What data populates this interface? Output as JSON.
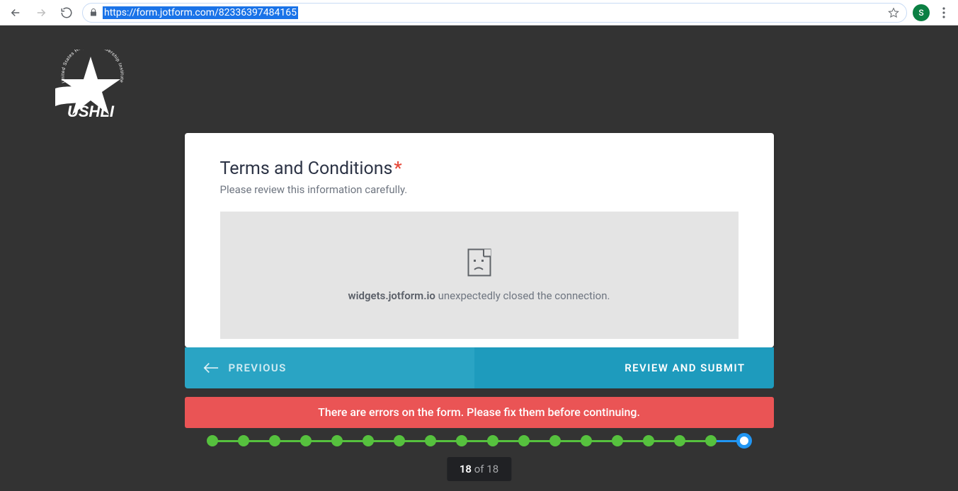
{
  "browser": {
    "url": "https://form.jotform.com/82336397484165",
    "profile_initial": "S"
  },
  "logo": {
    "org_name": "USHLI",
    "tagline": "United States Hispanic Leadership Institute"
  },
  "card": {
    "title": "Terms and Conditions",
    "required": true,
    "subtitle": "Please review this information carefully.",
    "embed_host": "widgets.jotform.io",
    "embed_msg_tail": " unexpectedly closed the connection."
  },
  "nav": {
    "prev_label": "PREVIOUS",
    "next_label": "REVIEW AND SUBMIT"
  },
  "error_text": "There are errors on the form. Please fix them before continuing.",
  "stepper": {
    "total": 18,
    "current": 18,
    "of_word": "of"
  }
}
